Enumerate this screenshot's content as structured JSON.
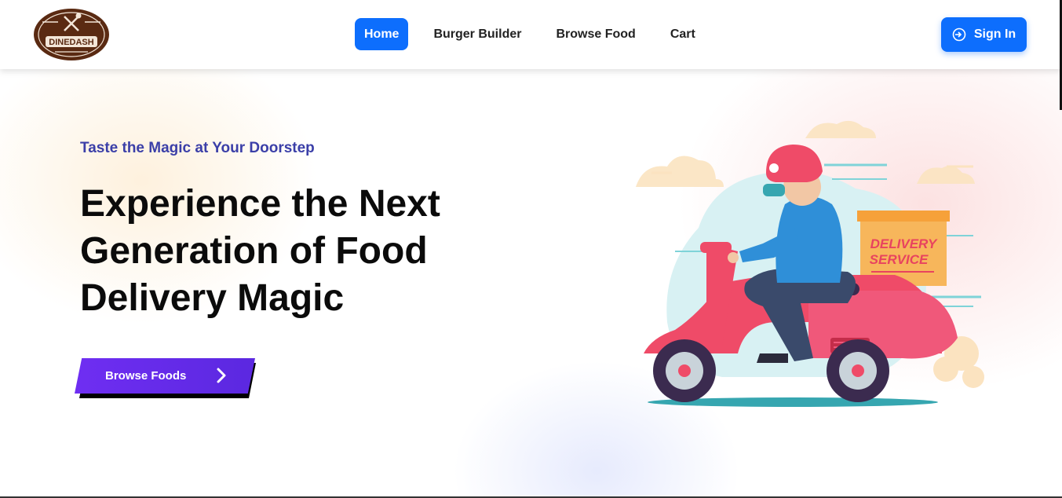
{
  "brand": {
    "logo_text": "DINEDASH"
  },
  "nav": {
    "links": [
      {
        "label": "Home",
        "active": true
      },
      {
        "label": "Burger Builder",
        "active": false
      },
      {
        "label": "Browse Food",
        "active": false
      },
      {
        "label": "Cart",
        "active": false
      }
    ],
    "signin_label": "Sign In"
  },
  "hero": {
    "tagline": "Taste the Magic at Your Doorstep",
    "headline_lines": [
      "Experience the Next",
      "Generation of Food",
      "Delivery Magic"
    ],
    "cta_label": "Browse Foods",
    "illustration_text": [
      "DELIVERY",
      "SERVICE"
    ]
  },
  "colors": {
    "primary": "#0d6efd",
    "cta": "#6f2ef2",
    "tagline": "#3b3fa8",
    "logo_brown": "#5a2a12",
    "scooter": "#ef4b68",
    "box": "#f7b65b"
  },
  "icons": [
    "dinedash-logo",
    "signin-icon",
    "chevron-right-icon",
    "delivery-scooter-illustration"
  ]
}
